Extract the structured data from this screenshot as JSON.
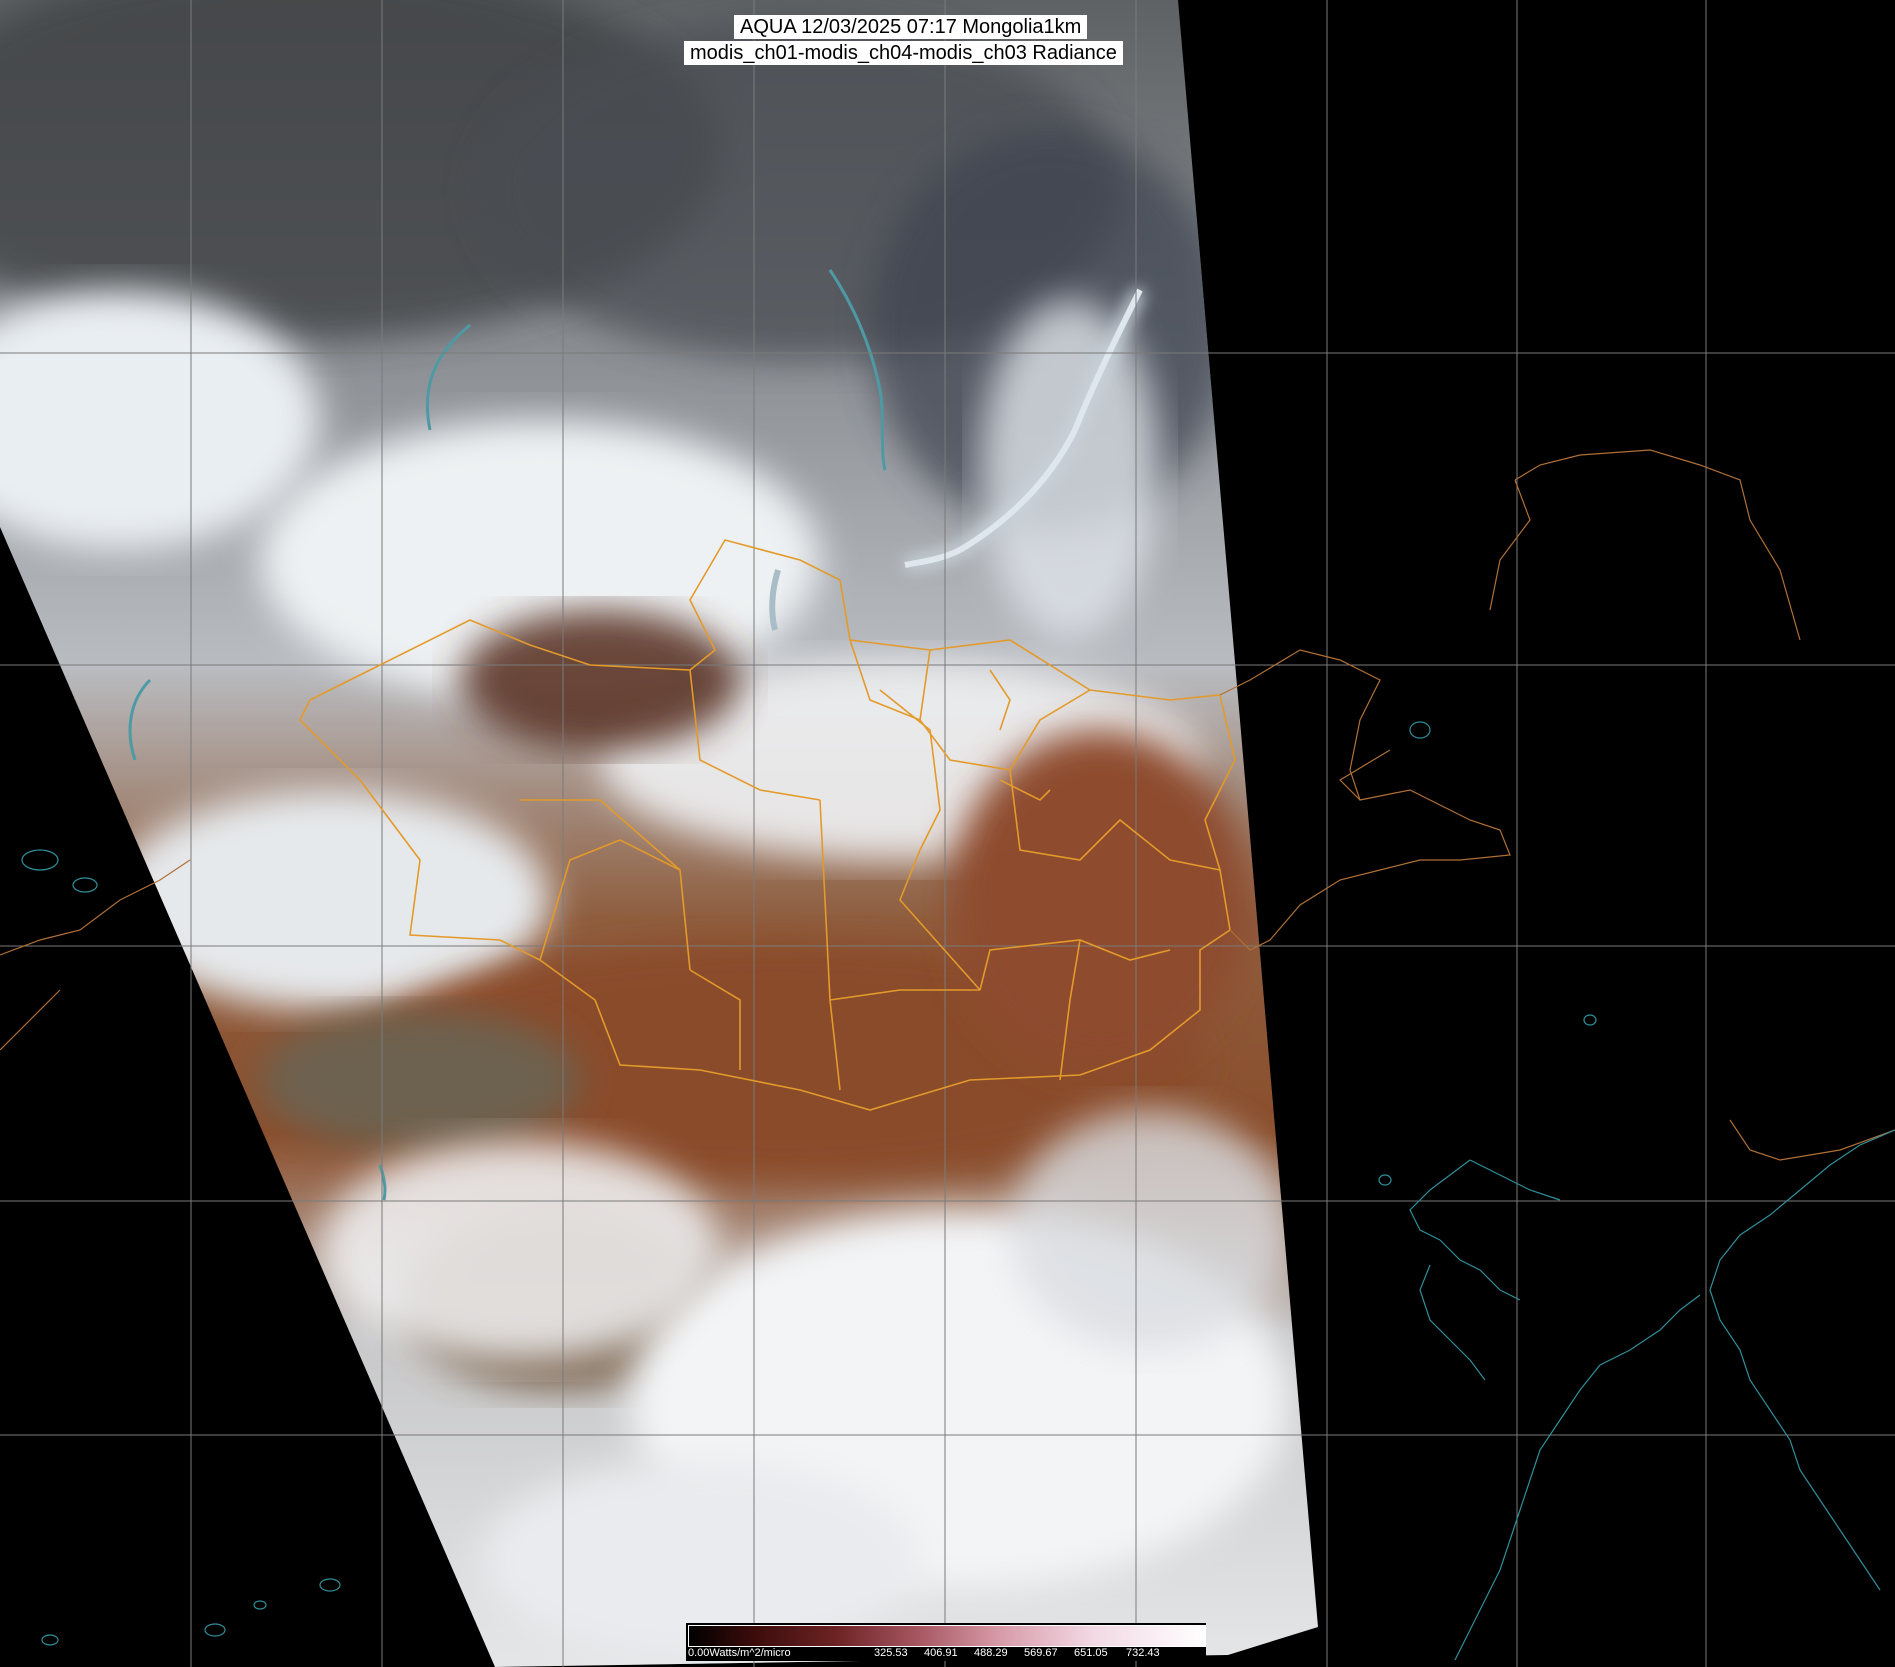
{
  "header": {
    "line1": "AQUA 12/03/2025 07:17 Mongolia1km",
    "line2": "modis_ch01-modis_ch04-modis_ch03 Radiance"
  },
  "colorbar": {
    "label": "0.00Watts/m^2/micro",
    "ticks": [
      "325.53",
      "406.91",
      "488.29",
      "569.67",
      "651.05",
      "732.43"
    ]
  },
  "colors": {
    "background": "#000000",
    "grid": "#7a7a7a",
    "province_border": "#e39a2a",
    "coastline": "#2f8f9a",
    "snow": "#e8ecef",
    "desert": "#8a4e2c"
  }
}
